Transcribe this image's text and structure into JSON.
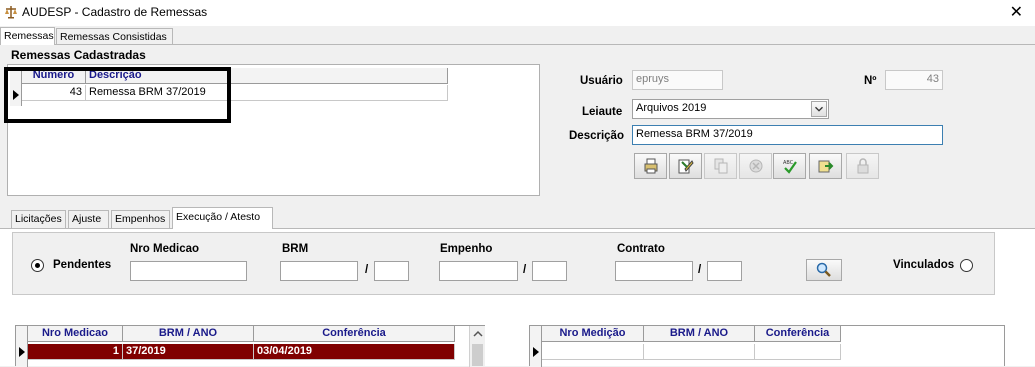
{
  "window": {
    "title": "AUDESP - Cadastro de Remessas",
    "close_glyph": "✕"
  },
  "top_tabs": [
    {
      "label": "Remessas",
      "active": true
    },
    {
      "label": "Remessas Consistidas",
      "active": false
    }
  ],
  "remessas_group": {
    "caption": "Remessas Cadastradas",
    "columns": [
      "Número",
      "Descrição"
    ],
    "rows": [
      {
        "numero": "43",
        "descricao": "Remessa BRM 37/2019"
      }
    ]
  },
  "form": {
    "usuario_label": "Usuário",
    "usuario_value": "epruys",
    "numero_label": "Nº",
    "numero_value": "43",
    "leiaute_label": "Leiaute",
    "leiaute_value": "Arquivos 2019",
    "descricao_label": "Descrição",
    "descricao_value": "Remessa BRM 37/2019"
  },
  "toolbar_icons": [
    "print-icon",
    "edit-document-icon",
    "document-disabled-icon",
    "cancel-disabled-icon",
    "spellcheck-icon",
    "export-icon",
    "lock-disabled-icon"
  ],
  "bottom_tabs": [
    {
      "label": "Licitações",
      "active": false
    },
    {
      "label": "Ajuste",
      "active": false
    },
    {
      "label": "Empenhos",
      "active": false
    },
    {
      "label": "Execução / Atesto",
      "active": true
    }
  ],
  "filters": {
    "pendentes_label": "Pendentes",
    "nro_medicao_label": "Nro Medicao",
    "brm_label": "BRM",
    "empenho_label": "Empenho",
    "contrato_label": "Contrato",
    "vinculados_label": "Vinculados",
    "slash": "/"
  },
  "left_grid": {
    "columns": [
      "Nro Medicao",
      "BRM / ANO",
      "Conferência"
    ],
    "rows": [
      {
        "nro": "1",
        "brm_ano": "37/2019",
        "conferencia": "03/04/2019"
      }
    ],
    "selected_color": "#800000"
  },
  "right_grid": {
    "columns": [
      "Nro Medição",
      "BRM / ANO",
      "Conferência"
    ]
  },
  "colors": {
    "header_text": "#1a1a8a",
    "focus_border": "#3c7fb1"
  }
}
